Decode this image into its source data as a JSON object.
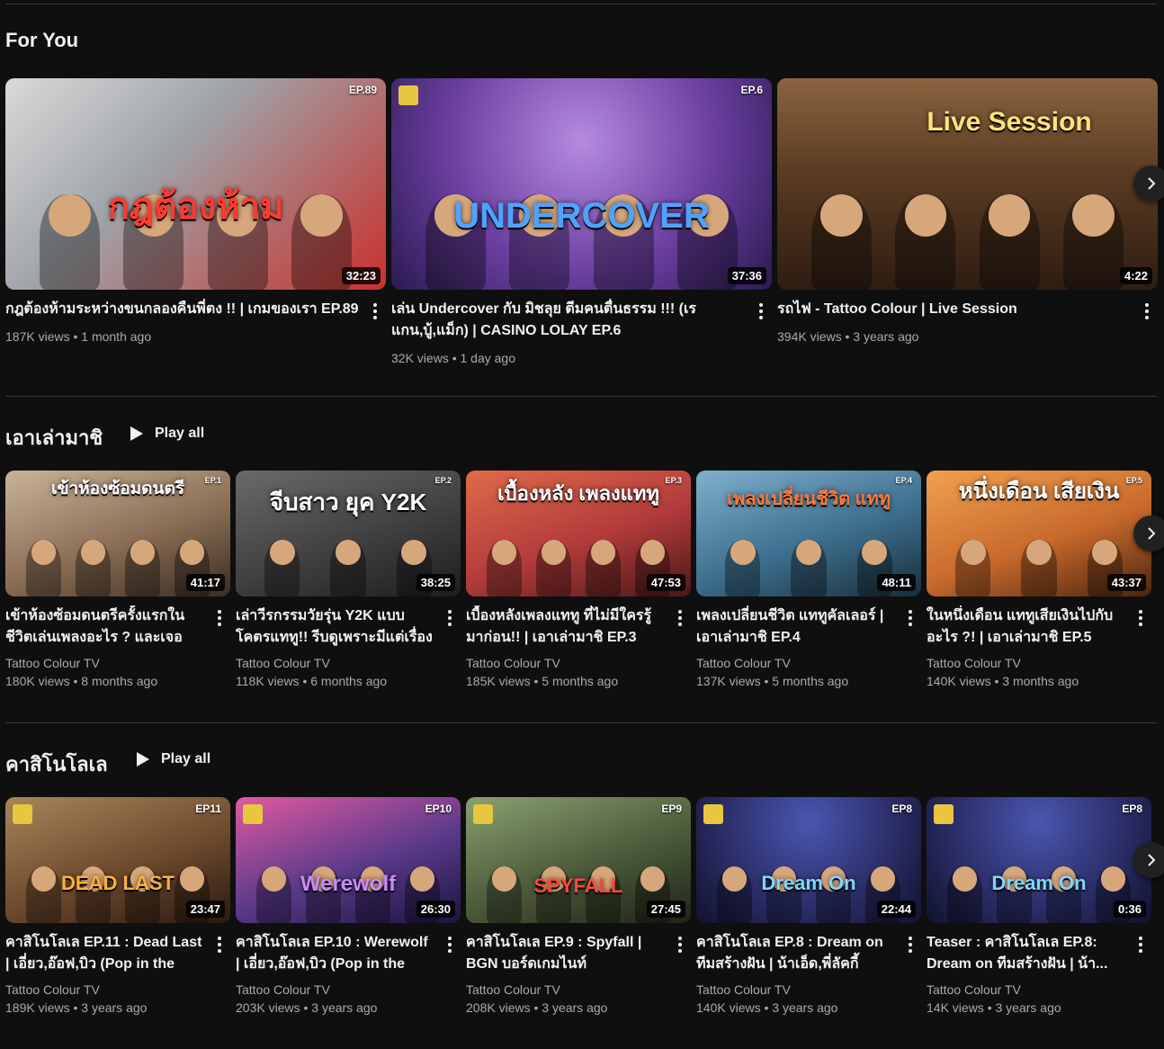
{
  "sections": [
    {
      "title": "For You",
      "play_all": "",
      "videos": [
        {
          "headline": "กฎต้องห้าม",
          "ep": "EP.89",
          "duration": "32:23",
          "title": "กฎต้องห้ามระหว่างขนกลองคืนพี่ตง !! | เกมของเรา EP.89",
          "channel": "",
          "stats": "187K views • 1 month ago",
          "bg": "#c9302c"
        },
        {
          "headline": "UNDERCOVER",
          "ep": "EP.6",
          "duration": "37:36",
          "title": "เล่น Undercover กับ มิชลุย ตีมคนตื่นธรรม !!! (เรแกน,บู้,แม็ก) | CASINO LOLAY EP.6",
          "channel": "",
          "stats": "32K views • 1 day ago",
          "bg": "#6b3fa0"
        },
        {
          "headline": "Live Session",
          "ep": "",
          "duration": "4:22",
          "title": "รถไฟ - Tattoo Colour | Live Session",
          "channel": "",
          "stats": "394K views • 3 years ago",
          "bg": "#7a4a2a"
        }
      ]
    },
    {
      "title": "เอาเล่ามาชิ",
      "play_all": "Play all",
      "videos": [
        {
          "headline": "เข้าห้องซ้อมดนตรี",
          "ep": "EP.1",
          "duration": "41:17",
          "title": "เข้าห้องซ้อมดนตรีครั้งแรกในชีวิตเล่นเพลงอะไร ? และเจอหน้...",
          "channel": "Tattoo Colour TV",
          "stats": "180K views • 8 months ago",
          "bg": "#8a6e55"
        },
        {
          "headline": "จีบสาว ยุค Y2K",
          "ep": "EP.2",
          "duration": "38:25",
          "title": "เล่าวีรกรรมวัยรุ่น Y2K แบบโคตรแททู!! รีบดูเพราะมีแต่เรื่องพีค...",
          "channel": "Tattoo Colour TV",
          "stats": "118K views • 6 months ago",
          "bg": "#3c3c3c"
        },
        {
          "headline": "เบื้องหลัง เพลงแททู",
          "ep": "EP.3",
          "duration": "47:53",
          "title": "เบื้องหลังเพลงแททู ที่ไม่มีใครรู้มาก่อน!! | เอาเล่ามาชิ EP.3",
          "channel": "Tattoo Colour TV",
          "stats": "185K views • 5 months ago",
          "bg": "#b23b3b"
        },
        {
          "headline": "เพลงเปลี่ยนชีวิต แททู",
          "ep": "EP.4",
          "duration": "48:11",
          "title": "เพลงเปลี่ยนชีวิต แททูคัลเลอร์ | เอาเล่ามาชิ EP.4",
          "channel": "Tattoo Colour TV",
          "stats": "137K views • 5 months ago",
          "bg": "#3d6f8e"
        },
        {
          "headline": "หนึ่งเดือน เสียเงิน",
          "ep": "EP.5",
          "duration": "43:37",
          "title": "ในหนึ่งเดือน แททูเสียเงินไปกับอะไร ?! | เอาเล่ามาชิ EP.5",
          "channel": "Tattoo Colour TV",
          "stats": "140K views • 3 months ago",
          "bg": "#c86a2c"
        }
      ]
    },
    {
      "title": "คาสิโนโลเล",
      "play_all": "Play all",
      "videos": [
        {
          "headline": "DEAD LAST",
          "ep": "EP11",
          "duration": "23:47",
          "title": "คาสิโนโลเล EP.11 : Dead Last | เอี่ยว,อ๊อฟ,บิว (Pop in the box)",
          "channel": "Tattoo Colour TV",
          "stats": "189K views • 3 years ago",
          "bg": "#6e4a2e"
        },
        {
          "headline": "Werewolf",
          "ep": "EP10",
          "duration": "26:30",
          "title": "คาสิโนโลเล EP.10 : Werewolf | เอี่ยว,อ๊อฟ,บิว (Pop in the box)",
          "channel": "Tattoo Colour TV",
          "stats": "203K views • 3 years ago",
          "bg": "#5a3a8a"
        },
        {
          "headline": "SPYFALL",
          "ep": "EP9",
          "duration": "27:45",
          "title": "คาสิโนโลเล EP.9 : Spyfall | BGN บอร์ดเกมไนท์",
          "channel": "Tattoo Colour TV",
          "stats": "208K views • 3 years ago",
          "bg": "#4b5a3a"
        },
        {
          "headline": "Dream On",
          "ep": "EP8",
          "duration": "22:44",
          "title": "คาสิโนโลเล EP.8 : Dream on ทีมสร้างฝัน | น้าเอ็ด,พี่ลัคกี้",
          "channel": "Tattoo Colour TV",
          "stats": "140K views • 3 years ago",
          "bg": "#2c2f6a"
        },
        {
          "headline": "Dream On",
          "ep": "EP8",
          "duration": "0:36",
          "title": "Teaser : คาสิโนโลเล EP.8: Dream on ทีมสร้างฝัน | น้า...",
          "channel": "Tattoo Colour TV",
          "stats": "14K views • 3 years ago",
          "bg": "#2c2f6a"
        }
      ]
    }
  ]
}
